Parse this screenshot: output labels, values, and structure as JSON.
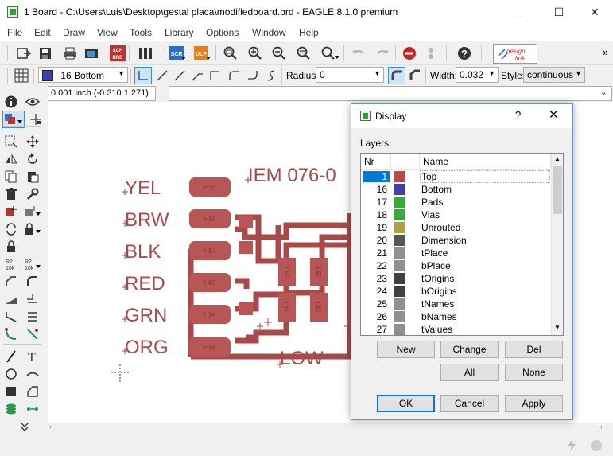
{
  "window": {
    "title": "1 Board - C:\\Users\\Luis\\Desktop\\gestal placa\\modifiedboard.brd - EAGLE 8.1.0 premium",
    "minimize_glyph": "—",
    "maximize_glyph": "☐",
    "close_glyph": "✕"
  },
  "menu": [
    "File",
    "Edit",
    "Draw",
    "View",
    "Tools",
    "Library",
    "Options",
    "Window",
    "Help"
  ],
  "toolbar": {
    "scr_label": "SCR",
    "ulp_label": "ULP",
    "sch_brd_label": "SCH BRD",
    "design_link_line1": "design",
    "design_link_line2": "link",
    "overflow": "»"
  },
  "wire_toolbar": {
    "layer_value": "16 Bottom",
    "layer_color": "#3f3fb0",
    "radius_label": "Radius:",
    "radius_value": "0",
    "width_label": "Width:",
    "width_value": "0.032",
    "style_label": "Style:",
    "style_value": "continuous"
  },
  "coordinate": "0.001 inch (-0.310 1.271)",
  "board": {
    "labels": [
      "YEL",
      "BRW",
      "BLK",
      "RED",
      "GRN",
      "ORG"
    ],
    "title_text": "IEM 076-0",
    "low_text": "LOW",
    "pad_names": [
      "H$6",
      "H$5",
      "H$7",
      "H$5",
      "H$4",
      "H$4"
    ],
    "smd_names": [
      "L$1",
      "L$1",
      "L$2",
      "L$2"
    ],
    "trace_color": "#a84a4a",
    "pad_color": "#b85555"
  },
  "dialog": {
    "title": "Display",
    "help_glyph": "?",
    "close_glyph": "✕",
    "layers_label": "Layers:",
    "col_nr": "Nr",
    "col_name": "Name",
    "layers": [
      {
        "nr": "1",
        "name": "Top",
        "color": "#b84a4a",
        "selected": true
      },
      {
        "nr": "16",
        "name": "Bottom",
        "color": "#3f3fb0",
        "selected": false
      },
      {
        "nr": "17",
        "name": "Pads",
        "color": "#3aa83a",
        "selected": false
      },
      {
        "nr": "18",
        "name": "Vias",
        "color": "#3aa83a",
        "selected": false
      },
      {
        "nr": "19",
        "name": "Unrouted",
        "color": "#b0a040",
        "selected": false
      },
      {
        "nr": "20",
        "name": "Dimension",
        "color": "#555555",
        "selected": false
      },
      {
        "nr": "21",
        "name": "tPlace",
        "color": "#909090",
        "selected": false
      },
      {
        "nr": "22",
        "name": "bPlace",
        "color": "#909090",
        "selected": false
      },
      {
        "nr": "23",
        "name": "tOrigins",
        "color": "#404040",
        "selected": false
      },
      {
        "nr": "24",
        "name": "bOrigins",
        "color": "#404040",
        "selected": false
      },
      {
        "nr": "25",
        "name": "tNames",
        "color": "#909090",
        "selected": false
      },
      {
        "nr": "26",
        "name": "bNames",
        "color": "#909090",
        "selected": false
      },
      {
        "nr": "27",
        "name": "tValues",
        "color": "#909090",
        "selected": false
      }
    ],
    "buttons": {
      "new": "New",
      "change": "Change",
      "del": "Del",
      "all": "All",
      "none": "None",
      "ok": "OK",
      "cancel": "Cancel",
      "apply": "Apply"
    }
  }
}
